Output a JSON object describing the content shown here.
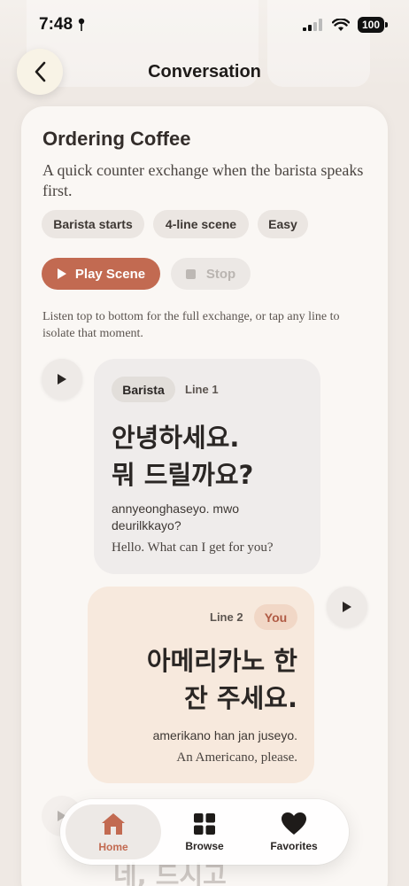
{
  "status_bar": {
    "time": "7:48",
    "battery": "100"
  },
  "header": {
    "title": "Conversation"
  },
  "scene": {
    "title": "Ordering Coffee",
    "description": "A quick counter exchange when the barista speaks first.",
    "chips": [
      "Barista starts",
      "4-line scene",
      "Easy"
    ],
    "play_label": "Play Scene",
    "stop_label": "Stop",
    "hint": "Listen top to bottom for the full exchange, or tap any line to isolate that moment."
  },
  "lines": [
    {
      "speaker": "Barista",
      "line_label": "Line 1",
      "korean_1": "안녕하세요.",
      "korean_2": "뭐 드릴까요?",
      "romanization_1": "annyeonghaseyo. mwo",
      "romanization_2": "deurilkkayo?",
      "english": "Hello. What can I get for you?"
    },
    {
      "speaker": "You",
      "line_label": "Line 2",
      "korean_1": "아메리카노 한",
      "korean_2": "잔 주세요.",
      "romanization": "amerikano han jan juseyo.",
      "english": "An Americano, please."
    },
    {
      "korean_partial": "네, 드시고"
    }
  ],
  "tabbar": {
    "items": [
      {
        "label": "Home",
        "icon": "home-icon"
      },
      {
        "label": "Browse",
        "icon": "grid-icon"
      },
      {
        "label": "Favorites",
        "icon": "heart-icon"
      }
    ]
  },
  "colors": {
    "accent": "#c26a51",
    "you_bubble": "#f7e9dd",
    "barista_bubble": "#efeceb"
  }
}
